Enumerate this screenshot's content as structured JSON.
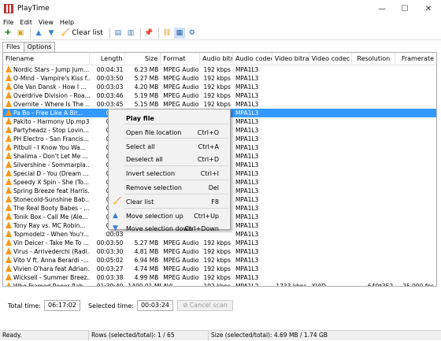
{
  "window": {
    "title": "PlayTime",
    "minimize": "—",
    "maximize": "☐",
    "close": "✕"
  },
  "menu": [
    "File",
    "Edit",
    "View",
    "Help"
  ],
  "toolbar": {
    "clear_list_label": "Clear list"
  },
  "tabs": [
    "Files",
    "Options"
  ],
  "columns": [
    "Filename",
    "Length",
    "Size",
    "Format",
    "Audio bitr...",
    "Audio codec",
    "Video bitrate",
    "Video codec",
    "Resolution",
    "Framerate"
  ],
  "rows": [
    [
      "Nordic Stars - Jump Jum...",
      "00:04:31",
      "6.23 MB",
      "MPEG Audio",
      "192 kbps",
      "MPA1L3",
      "",
      "",
      "",
      ""
    ],
    [
      "O-Mind - Vampire's Kiss f...",
      "00:03:50",
      "5.27 MB",
      "MPEG Audio",
      "192 kbps",
      "MPA1L3",
      "",
      "",
      "",
      ""
    ],
    [
      "Ole Van Dansk - How I ...",
      "00:03:03",
      "4.20 MB",
      "MPEG Audio",
      "192 kbps",
      "MPA1L3",
      "",
      "",
      "",
      ""
    ],
    [
      "Overdrive Division - Roa...",
      "00:03:46",
      "5.19 MB",
      "MPEG Audio",
      "192 kbps",
      "MPA1L3",
      "",
      "",
      "",
      ""
    ],
    [
      "Overnite - Where Is The ...",
      "00:03:45",
      "5.15 MB",
      "MPEG Audio",
      "192 kbps",
      "MPA1L3",
      "",
      "",
      "",
      ""
    ],
    [
      "Pa Bo  - Free Like A Bir...",
      "00:03",
      "",
      "",
      "",
      "MPA1L3",
      "",
      "",
      "",
      ""
    ],
    [
      "Pakito - Harmony Up.mp3",
      "00:03",
      "",
      "",
      "",
      "MPA1L3",
      "",
      "",
      "",
      ""
    ],
    [
      "Partyheadz - Stop Lovin...",
      "00:03",
      "",
      "",
      "",
      "MPA1L3",
      "",
      "",
      "",
      ""
    ],
    [
      "PH Electro - San Francis...",
      "00:03",
      "",
      "",
      "",
      "MPA1L3",
      "",
      "",
      "",
      ""
    ],
    [
      "Pitbull - I Know You Wa...",
      "00:03",
      "",
      "",
      "",
      "MPA1L3",
      "",
      "",
      "",
      ""
    ],
    [
      "Shalima - Don't Let Me ...",
      "00:03",
      "",
      "",
      "",
      "MPA1L3",
      "",
      "",
      "",
      ""
    ],
    [
      "Silvershine - Sommarpla...",
      "00:03",
      "",
      "",
      "",
      "MPA1L3",
      "",
      "",
      "",
      ""
    ],
    [
      "Special D - You (Dream ...",
      "00:03",
      "",
      "",
      "",
      "MPA1L3",
      "",
      "",
      "",
      ""
    ],
    [
      "Speedy X Spin - She (To...",
      "00:03",
      "",
      "",
      "",
      "MPA1L3",
      "",
      "",
      "",
      ""
    ],
    [
      "Spring Breeze feat Harris...",
      "00:03",
      "",
      "",
      "",
      "MPA1L3",
      "",
      "",
      "",
      ""
    ],
    [
      "Stonecold-Sunshine Bab...",
      "00:03",
      "",
      "",
      "",
      "MPA1L3",
      "",
      "",
      "",
      ""
    ],
    [
      "The Real Booty Babes - ...",
      "00:03",
      "",
      "",
      "",
      "MPA1L3",
      "",
      "",
      "",
      ""
    ],
    [
      "Tonik Box - Call Me (Ale...",
      "00:03",
      "",
      "",
      "",
      "MPA1L3",
      "",
      "",
      "",
      ""
    ],
    [
      "Tony Ray vs. MC Robin...",
      "00:03",
      "",
      "",
      "",
      "MPA1L3",
      "",
      "",
      "",
      ""
    ],
    [
      "Topmodelz - When You'r...",
      "00:03",
      "",
      "",
      "",
      "MPA1L3",
      "",
      "",
      "",
      ""
    ],
    [
      "Vin Deicer - Take Me To ...",
      "00:03:50",
      "5.27 MB",
      "MPEG Audio",
      "192 kbps",
      "MPA1L3",
      "",
      "",
      "",
      ""
    ],
    [
      "Virus - Arrivederchi (Radi...",
      "00:03:30",
      "4.81 MB",
      "MPEG Audio",
      "192 kbps",
      "MPA1L3",
      "",
      "",
      "",
      ""
    ],
    [
      "Vito V ft. Anna Berardi -...",
      "00:05:02",
      "6.94 MB",
      "MPEG Audio",
      "192 kbps",
      "MPA1L3",
      "",
      "",
      "",
      ""
    ],
    [
      "Vivien O'hara feat Adrian...",
      "00:03:27",
      "4.74 MB",
      "MPEG Audio",
      "192 kbps",
      "MPA1L3",
      "",
      "",
      "",
      ""
    ],
    [
      "Wicksell - Summer Breez...",
      "00:03:38",
      "4.99 MB",
      "MPEG Audio",
      "192 kbps",
      "MPA1L3",
      "",
      "",
      "",
      ""
    ],
    [
      "Who Framed Roger Rab...",
      "01:39:40",
      "1400.01 MB",
      "AVI",
      "192 kbps",
      "MPA1L2",
      "1733 kbps",
      "XVID",
      "640*352",
      "25.000 fps"
    ]
  ],
  "context_menu": [
    {
      "label": "Play file",
      "shortcut": "",
      "bold": true
    },
    {
      "label": "Open file location",
      "shortcut": "Ctrl+O"
    },
    {
      "label": "Select all",
      "shortcut": "Ctrl+A"
    },
    {
      "label": "Deselect all",
      "shortcut": "Ctrl+D"
    },
    {
      "label": "Invert selection",
      "shortcut": "Ctrl+I"
    },
    {
      "label": "Remove selection",
      "shortcut": "Del"
    },
    {
      "label": "Clear list",
      "shortcut": "F8"
    },
    {
      "label": "Move selection up",
      "shortcut": "Ctrl+Up"
    },
    {
      "label": "Move selection down",
      "shortcut": "Ctrl+Down"
    }
  ],
  "footer": {
    "total_time_label": "Total time:",
    "total_time_value": "06:17:02",
    "selected_time_label": "Selected time:",
    "selected_time_value": "00:03:24",
    "cancel_scan_label": "Cancel scan"
  },
  "status": {
    "ready": "Ready.",
    "rows": "Rows (selected/total): 1 / 65",
    "size": "Size (selected/total): 4.69 MB / 1.74 GB"
  },
  "selected_row_index": 5
}
